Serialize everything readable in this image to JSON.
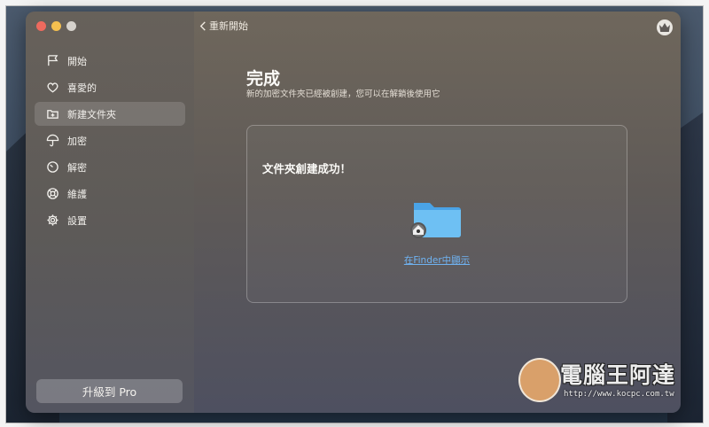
{
  "sidebar": {
    "items": [
      {
        "label": "開始",
        "icon": "flag-icon"
      },
      {
        "label": "喜愛的",
        "icon": "heart-icon"
      },
      {
        "label": "新建文件夾",
        "icon": "new-folder-icon",
        "active": true
      },
      {
        "label": "加密",
        "icon": "umbrella-icon"
      },
      {
        "label": "解密",
        "icon": "timer-icon"
      },
      {
        "label": "維護",
        "icon": "lifebuoy-icon"
      },
      {
        "label": "設置",
        "icon": "gear-icon"
      }
    ],
    "upgrade_label": "升級到 Pro"
  },
  "header": {
    "back_label": "重新開始",
    "crown_icon": "crown-icon"
  },
  "main": {
    "title": "完成",
    "subtitle": "新的加密文件夾已經被創建，您可以在解鎖後使用它",
    "card": {
      "heading": "文件夾創建成功！",
      "folder_icon": "folder-icon",
      "link": "在Finder中顯示"
    }
  },
  "watermark": {
    "text": "電腦王阿達",
    "url": "http://www.kocpc.com.tw"
  },
  "colors": {
    "accent_link": "#6fb3f2",
    "close": "#ed6a5e",
    "minimize": "#f4bf4f"
  }
}
